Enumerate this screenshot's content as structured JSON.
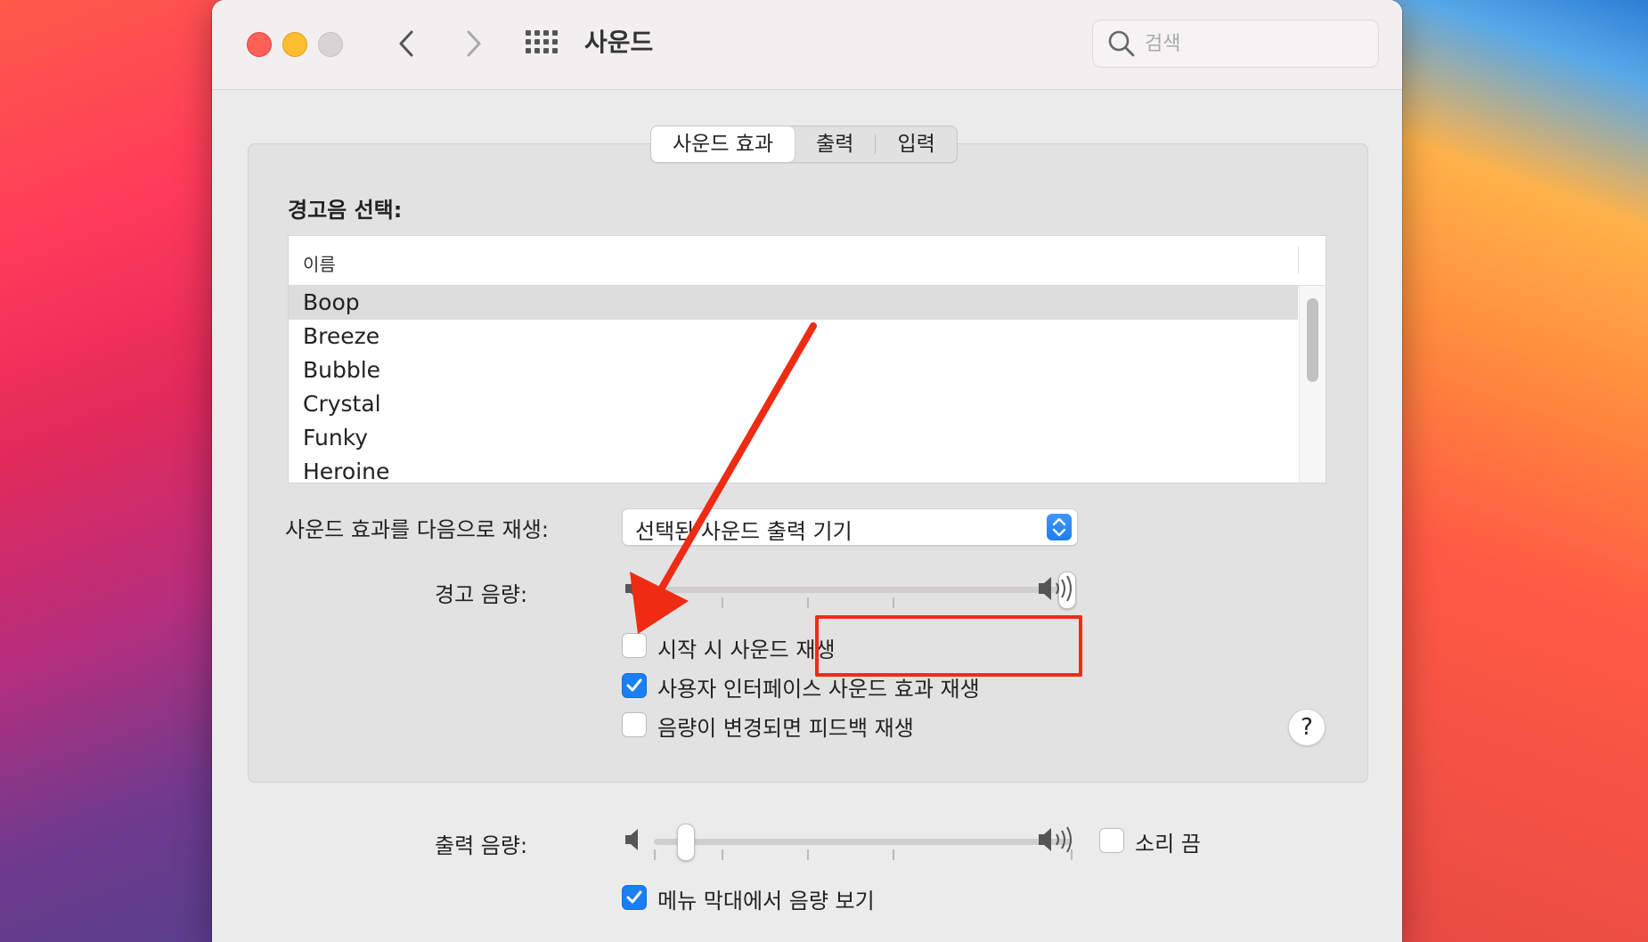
{
  "window": {
    "title": "사운드"
  },
  "search": {
    "placeholder": "검색"
  },
  "tabs": [
    {
      "label": "사운드 효과",
      "active": true
    },
    {
      "label": "출력",
      "active": false
    },
    {
      "label": "입력",
      "active": false
    }
  ],
  "alert_section": {
    "label": "경고음 선택:",
    "column_header": "이름",
    "items": [
      "Boop",
      "Breeze",
      "Bubble",
      "Crystal",
      "Funky",
      "Heroine"
    ],
    "selected": "Boop"
  },
  "play_through": {
    "label": "사운드 효과를 다음으로 재생:",
    "value": "선택된 사운드 출력 기기"
  },
  "alert_volume": {
    "label": "경고 음량:",
    "level": 1.0
  },
  "checkboxes": {
    "startup": {
      "label": "시작 시 사운드 재생",
      "checked": false
    },
    "ui_effects": {
      "label": "사용자 인터페이스 사운드 효과 재생",
      "checked": true
    },
    "feedback": {
      "label": "음량이 변경되면 피드백 재생",
      "checked": false
    },
    "mute": {
      "label": "소리 끔",
      "checked": false
    },
    "menubar": {
      "label": "메뉴 막대에서 음량 보기",
      "checked": true
    }
  },
  "output_volume": {
    "label": "출력 음량:",
    "level": 0.07
  },
  "help": {
    "label": "?"
  },
  "colors": {
    "accent": "#1a7ff3",
    "annotation": "#f02b14"
  }
}
